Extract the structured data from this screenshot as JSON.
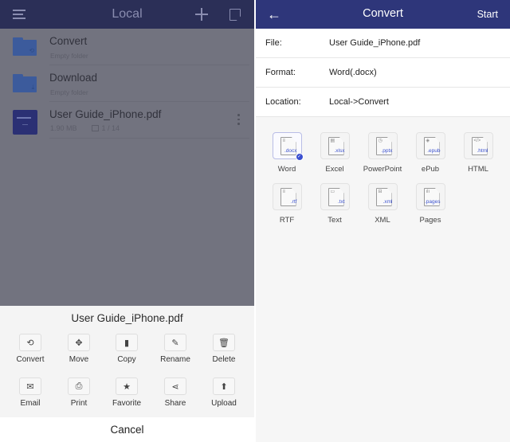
{
  "left": {
    "header": {
      "title": "Local",
      "icons": [
        "menu-icon",
        "plus-icon",
        "note-icon"
      ]
    },
    "files": [
      {
        "name": "Convert",
        "subtitle": "Empty folder",
        "type": "folder",
        "icon": "folder-convert-icon"
      },
      {
        "name": "Download",
        "subtitle": "Empty folder",
        "type": "folder",
        "icon": "folder-download-icon"
      },
      {
        "name": "User Guide_iPhone.pdf",
        "size": "1.90 MB",
        "pages": "1 / 14",
        "type": "pdf",
        "icon": "pdf-thumbnail"
      }
    ],
    "action_sheet": {
      "title": "User Guide_iPhone.pdf",
      "actions": [
        {
          "label": "Convert",
          "icon": "convert-icon",
          "glyph": "⟲"
        },
        {
          "label": "Move",
          "icon": "move-icon",
          "glyph": "✥"
        },
        {
          "label": "Copy",
          "icon": "copy-icon",
          "glyph": "▮"
        },
        {
          "label": "Rename",
          "icon": "pencil-icon",
          "glyph": "✎"
        },
        {
          "label": "Delete",
          "icon": "trash-icon",
          "glyph": "🗑"
        },
        {
          "label": "Email",
          "icon": "envelope-icon",
          "glyph": "✉"
        },
        {
          "label": "Print",
          "icon": "printer-icon",
          "glyph": "⎙"
        },
        {
          "label": "Favorite",
          "icon": "star-icon",
          "glyph": "★"
        },
        {
          "label": "Share",
          "icon": "share-icon",
          "glyph": "⋖"
        },
        {
          "label": "Upload",
          "icon": "upload-icon",
          "glyph": "⬆"
        }
      ],
      "cancel_label": "Cancel"
    }
  },
  "right": {
    "header": {
      "back_glyph": "←",
      "title": "Convert",
      "start_label": "Start"
    },
    "rows": [
      {
        "key": "File:",
        "value": "User Guide_iPhone.pdf"
      },
      {
        "key": "Format:",
        "value": "Word(.docx)"
      },
      {
        "key": "Location:",
        "value": "Local->Convert"
      }
    ],
    "formats": [
      {
        "label": "Word",
        "ext": ".docx",
        "glyph": "≡",
        "selected": true
      },
      {
        "label": "Excel",
        "ext": ".xlsx",
        "glyph": "▤",
        "selected": false
      },
      {
        "label": "PowerPoint",
        "ext": ".pptx",
        "glyph": "◷",
        "selected": false
      },
      {
        "label": "ePub",
        "ext": ".epub",
        "glyph": "◈",
        "selected": false
      },
      {
        "label": "HTML",
        "ext": ".html",
        "glyph": "</>",
        "selected": false
      },
      {
        "label": "RTF",
        "ext": ".rtf",
        "glyph": "≡",
        "selected": false
      },
      {
        "label": "Text",
        "ext": ".txt",
        "glyph": "▭",
        "selected": false
      },
      {
        "label": "XML",
        "ext": ".xml",
        "glyph": "⊟",
        "selected": false
      },
      {
        "label": "Pages",
        "ext": ".pages",
        "glyph": "ılı",
        "selected": false
      }
    ],
    "selected_check_glyph": "✓"
  },
  "colors": {
    "header_active": "#2e367a",
    "header_dimmed": "#2b2f57",
    "overlay": "#72737f",
    "accent_blue": "#3a4fd0"
  }
}
